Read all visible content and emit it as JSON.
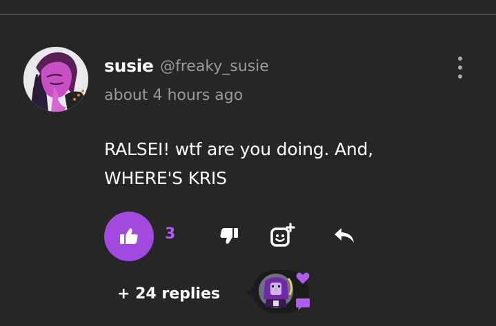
{
  "comment": {
    "username": "susie",
    "handle": "@freaky_susie",
    "timestamp": "about 4 hours ago",
    "text": "RALSEI! wtf are you doing. And, WHERE'S KRIS",
    "avatar_icon": "user-avatar",
    "more_icon": "more-vertical-icon"
  },
  "actions": {
    "like_icon": "thumbs-up-icon",
    "like_count": "3",
    "like_active": true,
    "dislike_icon": "thumbs-down-icon",
    "react_icon": "add-reaction-icon",
    "reply_icon": "reply-icon"
  },
  "replies": {
    "label": "+ 24 replies",
    "indicators": [
      "heart-icon",
      "chat-bubble-icon"
    ]
  },
  "colors": {
    "background": "#262626",
    "accent": "#a24ae0",
    "accent_text": "#b05cf0",
    "muted_text": "#9a9a9a",
    "primary_text": "#ffffff"
  }
}
